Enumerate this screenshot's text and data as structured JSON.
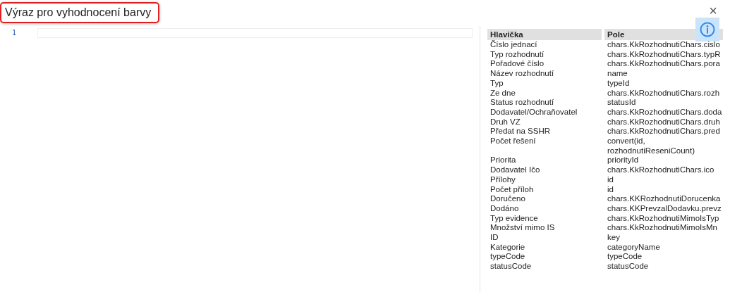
{
  "dialog": {
    "title": "Výraz pro vyhodnocení barvy",
    "close": "×"
  },
  "editor": {
    "line_numbers": [
      "1"
    ]
  },
  "table": {
    "columns": [
      "Hlavička",
      "Pole"
    ],
    "rows": [
      [
        "Číslo jednací",
        "chars.KkRozhodnutiChars.cislo"
      ],
      [
        "Typ rozhodnutí",
        "chars.KkRozhodnutiChars.typR"
      ],
      [
        "Pořadové číslo",
        "chars.KkRozhodnutiChars.pora"
      ],
      [
        "Název rozhodnutí",
        "name"
      ],
      [
        "Typ",
        "typeId"
      ],
      [
        "Ze dne",
        "chars.KkRozhodnutiChars.rozh"
      ],
      [
        "Status rozhodnutí",
        "statusId"
      ],
      [
        "Dodavatel/Ochraňovatel",
        "chars.KkRozhodnutiChars.doda"
      ],
      [
        "Druh VZ",
        "chars.KkRozhodnutiChars.druh"
      ],
      [
        "Předat na SSHR",
        "chars.KkRozhodnutiChars.pred"
      ],
      [
        "Počet řešení",
        "convert(id, rozhodnutiReseniCount)"
      ],
      [
        "Priorita",
        "priorityId"
      ],
      [
        "Dodavatel Ičo",
        "chars.KkRozhodnutiChars.ico"
      ],
      [
        "Přílohy",
        "id"
      ],
      [
        "Počet příloh",
        "id"
      ],
      [
        "Doručeno",
        "chars.KKRozhodnutiDorucenka"
      ],
      [
        "Dodáno",
        "chars.KKPrevzalDodavku.prevz"
      ],
      [
        "Typ evidence",
        "chars.KkRozhodnutiMimoIsTyp"
      ],
      [
        "Množství mimo IS",
        "chars.KkRozhodnutiMimoIsMn"
      ],
      [
        "ID",
        "key"
      ],
      [
        "Kategorie",
        "categoryName"
      ],
      [
        "typeCode",
        "typeCode"
      ],
      [
        "statusCode",
        "statusCode"
      ]
    ]
  }
}
